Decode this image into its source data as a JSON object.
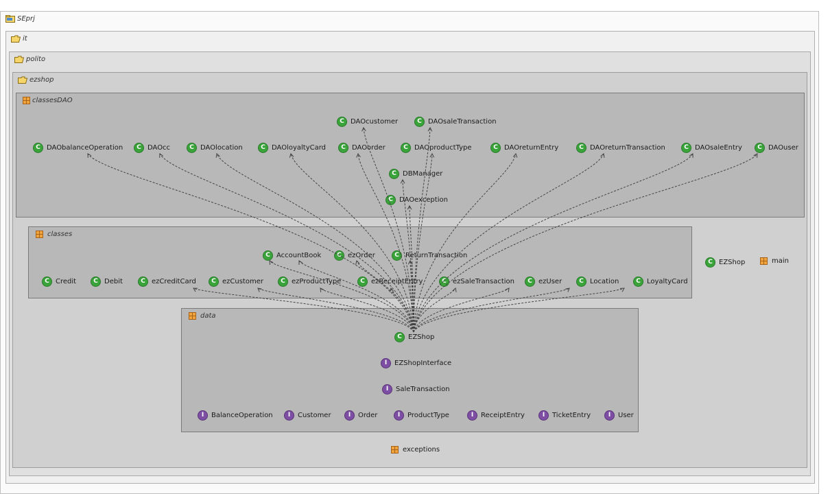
{
  "packages": {
    "root": "SEprj",
    "it": "it",
    "polito": "polito",
    "ezshop": "ezshop",
    "classesDAO": "classesDAO",
    "classes": "classes",
    "data": "data",
    "exceptions": "exceptions",
    "main": "main"
  },
  "classesDAO": {
    "items": [
      "DAOcustomer",
      "DAOsaleTransaction",
      "DAObalanceOperation",
      "DAOcc",
      "DAOlocation",
      "DAOloyaltyCard",
      "DAOorder",
      "DAOproductType",
      "DAOreturnEntry",
      "DAOreturnTransaction",
      "DAOsaleEntry",
      "DAOuser",
      "DBManager",
      "DAOexception"
    ]
  },
  "classes": {
    "items": [
      "AccountBook",
      "ezOrder",
      "ReturnTransaction",
      "Credit",
      "Debit",
      "ezCreditCard",
      "ezCustomer",
      "ezProductType",
      "ezReceiptEntry",
      "ezSaleTransaction",
      "ezUser",
      "Location",
      "LoyaltyCard"
    ]
  },
  "ezshop_class": "EZShop",
  "data": {
    "classes": [
      "EZShop"
    ],
    "interfaces": [
      "EZShopInterface",
      "SaleTransaction",
      "BalanceOperation",
      "Customer",
      "Order",
      "ProductType",
      "ReceiptEntry",
      "TicketEntry",
      "User"
    ]
  },
  "badges": {
    "class": "C",
    "interface": "I"
  },
  "colors": {
    "class_badge": "#3aa33a",
    "interface_badge": "#7d4ea3"
  }
}
